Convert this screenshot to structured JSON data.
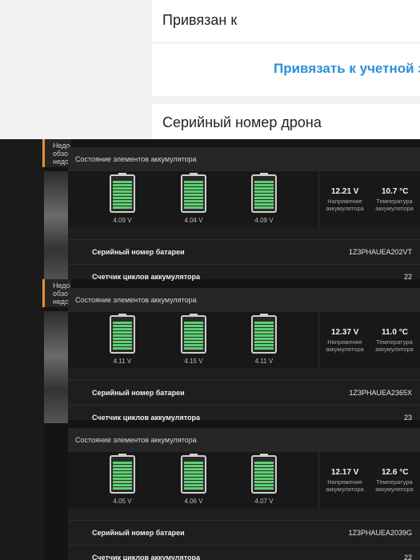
{
  "settings": {
    "bound_label": "Привязан к",
    "link_action": "Привязать к учетной з",
    "drone_serial_label": "Серийный номер дрона"
  },
  "alerts": [
    {
      "lines": [
        "Недо",
        "обзо",
        "недо"
      ]
    },
    {
      "lines": [
        "Недо",
        "обзо",
        "недо"
      ]
    }
  ],
  "batteries": [
    {
      "header": "Состояние элементов аккумулятора",
      "cells": [
        "4.09 V",
        "4.04 V",
        "4.09 V"
      ],
      "voltage_value": "12.21 V",
      "voltage_label": "Напряжение аккумулятора",
      "temp_value": "10.7 °C",
      "temp_label": "Температура аккумулятора",
      "serial_label": "Серийный номер батареи",
      "serial_value": "1Z3PHAUEA202VT",
      "cycles_label": "Счетчик циклов аккумулятора",
      "cycles_value": "22"
    },
    {
      "header": "Состояние элементов аккумулятора",
      "cells": [
        "4.11 V",
        "4.15 V",
        "4.11 V"
      ],
      "voltage_value": "12.37 V",
      "voltage_label": "Напряжение аккумулятора",
      "temp_value": "11.0 °C",
      "temp_label": "Температура аккумулятора",
      "serial_label": "Серийный номер батареи",
      "serial_value": "1Z3PHAUEA2365X",
      "cycles_label": "Счетчик циклов аккумулятора",
      "cycles_value": "23"
    },
    {
      "header": "Состояние элементов аккумулятора",
      "cells": [
        "4.05 V",
        "4.06 V",
        "4.07 V"
      ],
      "voltage_value": "12.17 V",
      "voltage_label": "Напряжение аккумулятора",
      "temp_value": "12.6 °C",
      "temp_label": "Температура аккумулятора",
      "serial_label": "Серийный номер батареи",
      "serial_value": "1Z3PHAUEA2039G",
      "cycles_label": "Счетчик циклов аккумулятора",
      "cycles_value": "22"
    }
  ],
  "colors": {
    "link": "#2b90d9",
    "cell_fill": "#5fcf73",
    "alert_accent": "#e8912d"
  }
}
